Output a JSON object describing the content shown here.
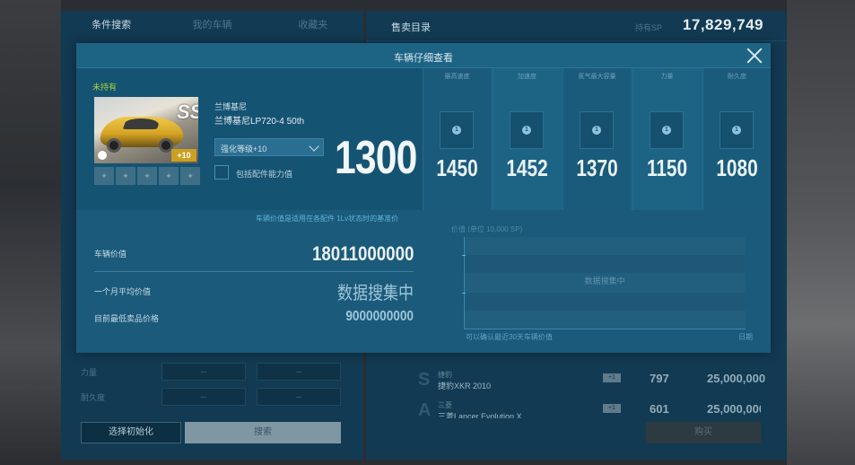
{
  "background": {
    "tabs": [
      {
        "label": "条件搜索"
      },
      {
        "label": "我的车辆"
      },
      {
        "label": "收藏夹"
      }
    ],
    "sale_title": "售卖目录",
    "sp_label": "持有SP",
    "sp_value": "17,829,749",
    "filters": [
      {
        "label": "力量",
        "options": [
          "--",
          "--"
        ]
      },
      {
        "label": "耐久度",
        "options": [
          "--",
          "--"
        ]
      }
    ],
    "reset_label": "选择初始化",
    "search_label": "搜索",
    "listings": [
      {
        "grade": "S",
        "brand": "捷豹",
        "name": "捷豹XKR 2010",
        "plus": "+1",
        "power": "797",
        "price": "25,000,000"
      },
      {
        "grade": "A",
        "brand": "三菱",
        "name": "三菱Lancer Evolution X",
        "plus": "+1",
        "power": "601",
        "price": "25,000,000"
      }
    ],
    "buy_label": "购买"
  },
  "modal": {
    "title": "车辆仔细查看",
    "owned_status": "未持有",
    "car": {
      "grade": "SS",
      "plus_badge": "+10",
      "brand": "兰博基尼",
      "model": "兰博基尼LP720-4 50th",
      "tune_level": "强化等级+10",
      "checkbox_label": "包括配件能力值",
      "power": "1300",
      "part_slot_icons": [
        "wrench-icon",
        "wrench-icon",
        "wrench-icon",
        "wrench-icon",
        "wrench-icon"
      ]
    },
    "stats": [
      {
        "label": "最高速度",
        "value": "1450",
        "badge": "1"
      },
      {
        "label": "加速度",
        "value": "1452",
        "badge": "1"
      },
      {
        "label": "氮气最大容量",
        "value": "1370",
        "badge": "1"
      },
      {
        "label": "力量",
        "value": "1150",
        "badge": "1"
      },
      {
        "label": "耐久度",
        "value": "1080",
        "badge": "1"
      }
    ],
    "price_note": "车辆价值是适用在各配件 1Lv状态时的基准价",
    "prices": [
      {
        "label": "车辆价值",
        "value": "18011000000"
      },
      {
        "label": "一个月平均价值",
        "value": "数据搜集中"
      },
      {
        "label": "目前最低卖品价格",
        "value": "9000000000"
      }
    ],
    "chart": {
      "title": "价值 (单位 10,000 SP)",
      "message": "数据搜集中",
      "footnote": "可以确认最近30天车辆价值",
      "x_label": "日期"
    }
  },
  "colors": {
    "owned_status": "#a8d33c",
    "accent": "#5fb2dc",
    "modal_bg": "#1b5a7a"
  }
}
